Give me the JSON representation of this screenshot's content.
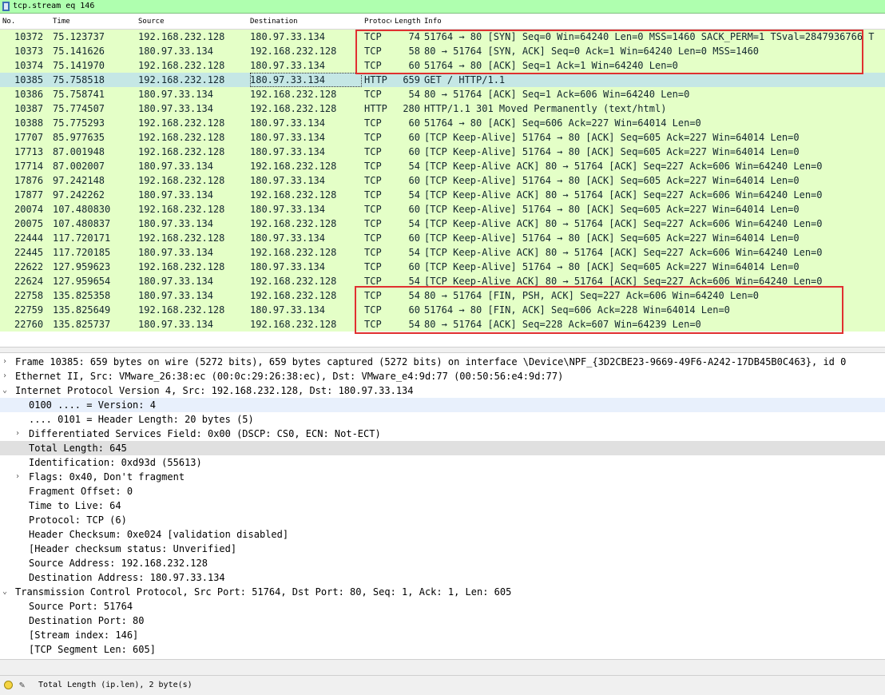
{
  "filter": {
    "value": "tcp.stream eq 146"
  },
  "columns": [
    "No.",
    "Time",
    "Source",
    "Destination",
    "Protocol",
    "Length",
    "Info"
  ],
  "packets": [
    {
      "no": "10372",
      "time": "75.123737",
      "src": "192.168.232.128",
      "dst": "180.97.33.134",
      "proto": "TCP",
      "len": "74",
      "info": "51764 → 80 [SYN] Seq=0 Win=64240 Len=0 MSS=1460 SACK_PERM=1 TSval=2847936766 T"
    },
    {
      "no": "10373",
      "time": "75.141626",
      "src": "180.97.33.134",
      "dst": "192.168.232.128",
      "proto": "TCP",
      "len": "58",
      "info": "80 → 51764 [SYN, ACK] Seq=0 Ack=1 Win=64240 Len=0 MSS=1460"
    },
    {
      "no": "10374",
      "time": "75.141970",
      "src": "192.168.232.128",
      "dst": "180.97.33.134",
      "proto": "TCP",
      "len": "60",
      "info": "51764 → 80 [ACK] Seq=1 Ack=1 Win=64240 Len=0"
    },
    {
      "no": "10385",
      "time": "75.758518",
      "src": "192.168.232.128",
      "dst": "180.97.33.134",
      "proto": "HTTP",
      "len": "659",
      "info": "GET / HTTP/1.1"
    },
    {
      "no": "10386",
      "time": "75.758741",
      "src": "180.97.33.134",
      "dst": "192.168.232.128",
      "proto": "TCP",
      "len": "54",
      "info": "80 → 51764 [ACK] Seq=1 Ack=606 Win=64240 Len=0"
    },
    {
      "no": "10387",
      "time": "75.774507",
      "src": "180.97.33.134",
      "dst": "192.168.232.128",
      "proto": "HTTP",
      "len": "280",
      "info": "HTTP/1.1 301 Moved Permanently  (text/html)"
    },
    {
      "no": "10388",
      "time": "75.775293",
      "src": "192.168.232.128",
      "dst": "180.97.33.134",
      "proto": "TCP",
      "len": "60",
      "info": "51764 → 80 [ACK] Seq=606 Ack=227 Win=64014 Len=0"
    },
    {
      "no": "17707",
      "time": "85.977635",
      "src": "192.168.232.128",
      "dst": "180.97.33.134",
      "proto": "TCP",
      "len": "60",
      "info": "[TCP Keep-Alive] 51764 → 80 [ACK] Seq=605 Ack=227 Win=64014 Len=0"
    },
    {
      "no": "17713",
      "time": "87.001948",
      "src": "192.168.232.128",
      "dst": "180.97.33.134",
      "proto": "TCP",
      "len": "60",
      "info": "[TCP Keep-Alive] 51764 → 80 [ACK] Seq=605 Ack=227 Win=64014 Len=0"
    },
    {
      "no": "17714",
      "time": "87.002007",
      "src": "180.97.33.134",
      "dst": "192.168.232.128",
      "proto": "TCP",
      "len": "54",
      "info": "[TCP Keep-Alive ACK] 80 → 51764 [ACK] Seq=227 Ack=606 Win=64240 Len=0"
    },
    {
      "no": "17876",
      "time": "97.242148",
      "src": "192.168.232.128",
      "dst": "180.97.33.134",
      "proto": "TCP",
      "len": "60",
      "info": "[TCP Keep-Alive] 51764 → 80 [ACK] Seq=605 Ack=227 Win=64014 Len=0"
    },
    {
      "no": "17877",
      "time": "97.242262",
      "src": "180.97.33.134",
      "dst": "192.168.232.128",
      "proto": "TCP",
      "len": "54",
      "info": "[TCP Keep-Alive ACK] 80 → 51764 [ACK] Seq=227 Ack=606 Win=64240 Len=0"
    },
    {
      "no": "20074",
      "time": "107.480830",
      "src": "192.168.232.128",
      "dst": "180.97.33.134",
      "proto": "TCP",
      "len": "60",
      "info": "[TCP Keep-Alive] 51764 → 80 [ACK] Seq=605 Ack=227 Win=64014 Len=0"
    },
    {
      "no": "20075",
      "time": "107.480837",
      "src": "180.97.33.134",
      "dst": "192.168.232.128",
      "proto": "TCP",
      "len": "54",
      "info": "[TCP Keep-Alive ACK] 80 → 51764 [ACK] Seq=227 Ack=606 Win=64240 Len=0"
    },
    {
      "no": "22444",
      "time": "117.720171",
      "src": "192.168.232.128",
      "dst": "180.97.33.134",
      "proto": "TCP",
      "len": "60",
      "info": "[TCP Keep-Alive] 51764 → 80 [ACK] Seq=605 Ack=227 Win=64014 Len=0"
    },
    {
      "no": "22445",
      "time": "117.720185",
      "src": "180.97.33.134",
      "dst": "192.168.232.128",
      "proto": "TCP",
      "len": "54",
      "info": "[TCP Keep-Alive ACK] 80 → 51764 [ACK] Seq=227 Ack=606 Win=64240 Len=0"
    },
    {
      "no": "22622",
      "time": "127.959623",
      "src": "192.168.232.128",
      "dst": "180.97.33.134",
      "proto": "TCP",
      "len": "60",
      "info": "[TCP Keep-Alive] 51764 → 80 [ACK] Seq=605 Ack=227 Win=64014 Len=0"
    },
    {
      "no": "22624",
      "time": "127.959654",
      "src": "180.97.33.134",
      "dst": "192.168.232.128",
      "proto": "TCP",
      "len": "54",
      "info": "[TCP Keep-Alive ACK] 80 → 51764 [ACK] Seq=227 Ack=606 Win=64240 Len=0"
    },
    {
      "no": "22758",
      "time": "135.825358",
      "src": "180.97.33.134",
      "dst": "192.168.232.128",
      "proto": "TCP",
      "len": "54",
      "info": "80 → 51764 [FIN, PSH, ACK] Seq=227 Ack=606 Win=64240 Len=0"
    },
    {
      "no": "22759",
      "time": "135.825649",
      "src": "192.168.232.128",
      "dst": "180.97.33.134",
      "proto": "TCP",
      "len": "60",
      "info": "51764 → 80 [FIN, ACK] Seq=606 Ack=228 Win=64014 Len=0"
    },
    {
      "no": "22760",
      "time": "135.825737",
      "src": "180.97.33.134",
      "dst": "192.168.232.128",
      "proto": "TCP",
      "len": "54",
      "info": "80 → 51764 [ACK] Seq=228 Ack=607 Win=64239 Len=0"
    }
  ],
  "details": [
    {
      "indent": 0,
      "arrow": "›",
      "text": "Frame 10385: 659 bytes on wire (5272 bits), 659 bytes captured (5272 bits) on interface \\Device\\NPF_{3D2CBE23-9669-49F6-A242-17DB45B0C463}, id 0"
    },
    {
      "indent": 0,
      "arrow": "›",
      "text": "Ethernet II, Src: VMware_26:38:ec (00:0c:29:26:38:ec), Dst: VMware_e4:9d:77 (00:50:56:e4:9d:77)"
    },
    {
      "indent": 0,
      "arrow": "⌄",
      "text": "Internet Protocol Version 4, Src: 192.168.232.128, Dst: 180.97.33.134"
    },
    {
      "indent": 1,
      "arrow": "",
      "text": "0100 .... = Version: 4"
    },
    {
      "indent": 1,
      "arrow": "",
      "text": ".... 0101 = Header Length: 20 bytes (5)"
    },
    {
      "indent": 1,
      "arrow": "›",
      "text": "Differentiated Services Field: 0x00 (DSCP: CS0, ECN: Not-ECT)"
    },
    {
      "indent": 1,
      "arrow": "",
      "text": "Total Length: 645"
    },
    {
      "indent": 1,
      "arrow": "",
      "text": "Identification: 0xd93d (55613)"
    },
    {
      "indent": 1,
      "arrow": "›",
      "text": "Flags: 0x40, Don't fragment"
    },
    {
      "indent": 1,
      "arrow": "",
      "text": "Fragment Offset: 0"
    },
    {
      "indent": 1,
      "arrow": "",
      "text": "Time to Live: 64"
    },
    {
      "indent": 1,
      "arrow": "",
      "text": "Protocol: TCP (6)"
    },
    {
      "indent": 1,
      "arrow": "",
      "text": "Header Checksum: 0xe024 [validation disabled]"
    },
    {
      "indent": 1,
      "arrow": "",
      "text": "[Header checksum status: Unverified]"
    },
    {
      "indent": 1,
      "arrow": "",
      "text": "Source Address: 192.168.232.128"
    },
    {
      "indent": 1,
      "arrow": "",
      "text": "Destination Address: 180.97.33.134"
    },
    {
      "indent": 0,
      "arrow": "⌄",
      "text": "Transmission Control Protocol, Src Port: 51764, Dst Port: 80, Seq: 1, Ack: 1, Len: 605"
    },
    {
      "indent": 1,
      "arrow": "",
      "text": "Source Port: 51764"
    },
    {
      "indent": 1,
      "arrow": "",
      "text": "Destination Port: 80"
    },
    {
      "indent": 1,
      "arrow": "",
      "text": "[Stream index: 146]"
    },
    {
      "indent": 1,
      "arrow": "",
      "text": "[TCP Segment Len: 605]"
    }
  ],
  "status": {
    "text": "Total Length (ip.len), 2 byte(s)"
  },
  "colors": {
    "tcp_row": "#e4ffc7",
    "selected_row": "#c5e7e5",
    "filter_ok": "#afffaf",
    "annotation": "#e03030"
  }
}
